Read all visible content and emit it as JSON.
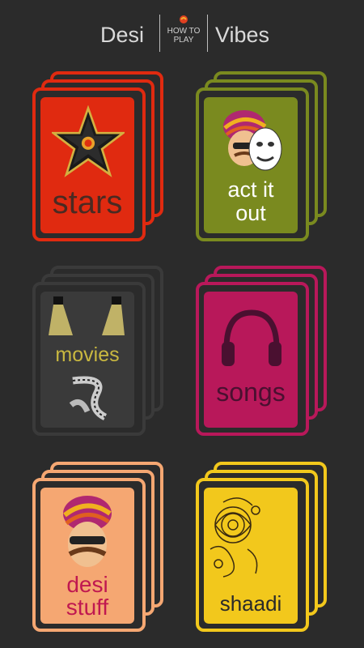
{
  "header": {
    "left_title": "Desi",
    "right_title": "Vibes",
    "howto_line1": "HOW TO",
    "howto_line2": "PLAY"
  },
  "categories": [
    {
      "label": "stars",
      "color": "#e02a10",
      "face": "#e02a10",
      "text": "#4a2a22",
      "icon": "star-icon"
    },
    {
      "label_line1": "act it",
      "label_line2": "out",
      "color": "#7a8a1f",
      "face": "#7a8a1f",
      "text": "#ffffff",
      "icon": "turban-mask-icon"
    },
    {
      "label": "movies",
      "color": "#3a3a3a",
      "face": "#3a3a3a",
      "text": "#c9b840",
      "icon": "spotlight-film-icon"
    },
    {
      "label": "songs",
      "color": "#b8185a",
      "face": "#b8185a",
      "text": "#4a1030",
      "icon": "headphones-icon"
    },
    {
      "label_line1": "desi",
      "label_line2": "stuff",
      "color": "#f5a772",
      "face": "#f5a772",
      "text": "#c01850",
      "icon": "turban-man-icon"
    },
    {
      "label": "shaadi",
      "color": "#f2c81c",
      "face": "#f2c81c",
      "text": "#2a2a2a",
      "icon": "henna-pattern-icon"
    }
  ]
}
